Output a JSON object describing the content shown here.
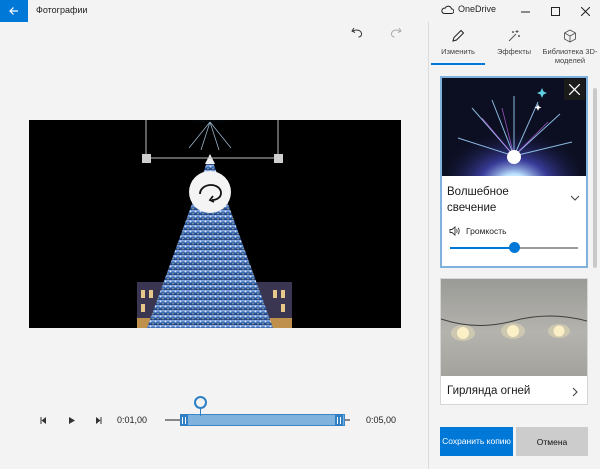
{
  "titlebar": {
    "app_title": "Фотографии",
    "onedrive_label": "OneDrive"
  },
  "timeline": {
    "current_time": "0:01,00",
    "end_time": "0:05,00",
    "playhead_fraction": 0.2
  },
  "panel": {
    "tabs": [
      {
        "label": "Изменить",
        "icon": "pencil-icon",
        "active": true
      },
      {
        "label": "Эффекты",
        "icon": "sparkle-icon",
        "active": false
      },
      {
        "label": "Библиотека 3D-моделей",
        "icon": "cube-icon",
        "active": false
      }
    ],
    "effect1": {
      "title": "Волшебное свечение",
      "volume_label": "Громкость",
      "volume_level": 0.5
    },
    "effect2": {
      "title": "Гирлянда огней"
    },
    "save_label": "Сохранить копию",
    "cancel_label": "Отмена"
  },
  "colors": {
    "accent": "#0078d7"
  }
}
